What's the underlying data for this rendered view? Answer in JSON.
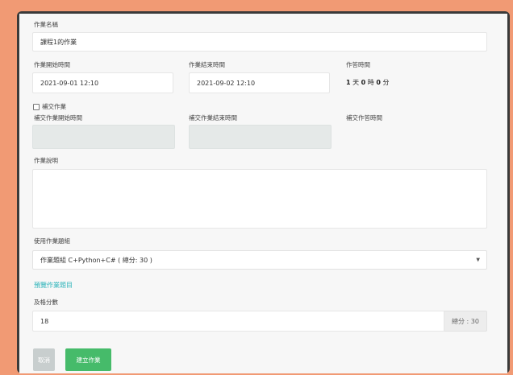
{
  "form": {
    "name_label": "作業名稱",
    "name_value": "課程1的作業",
    "start_label": "作業開始時間",
    "start_value": "2021-09-01 12:10",
    "end_label": "作業結束時間",
    "end_value": "2021-09-02 12:10",
    "duration_label": "作答時間",
    "duration_days": "1",
    "duration_days_unit": "天",
    "duration_hours": "0",
    "duration_hours_unit": "時",
    "duration_minutes": "0",
    "duration_minutes_unit": "分",
    "late_checkbox_label": "補交作業",
    "late_start_label": "補交作業開始時間",
    "late_end_label": "補交作業結束時間",
    "late_duration_label": "補交作答時間",
    "description_label": "作業說明",
    "description_value": "",
    "question_group_label": "使用作業題組",
    "question_group_value": "作業題組 C+Python+C# ( 總分: 30 )",
    "preview_link": "預覽作業題目",
    "pass_score_label": "及格分數",
    "pass_score_value": "18",
    "total_score_addon": "總分 : 30"
  },
  "buttons": {
    "cancel": "取消",
    "create": "建立作業"
  },
  "colors": {
    "background": "#F19A74",
    "link": "#2BB3B9",
    "create_button": "#46BB6A",
    "cancel_button": "#C8CECE"
  }
}
